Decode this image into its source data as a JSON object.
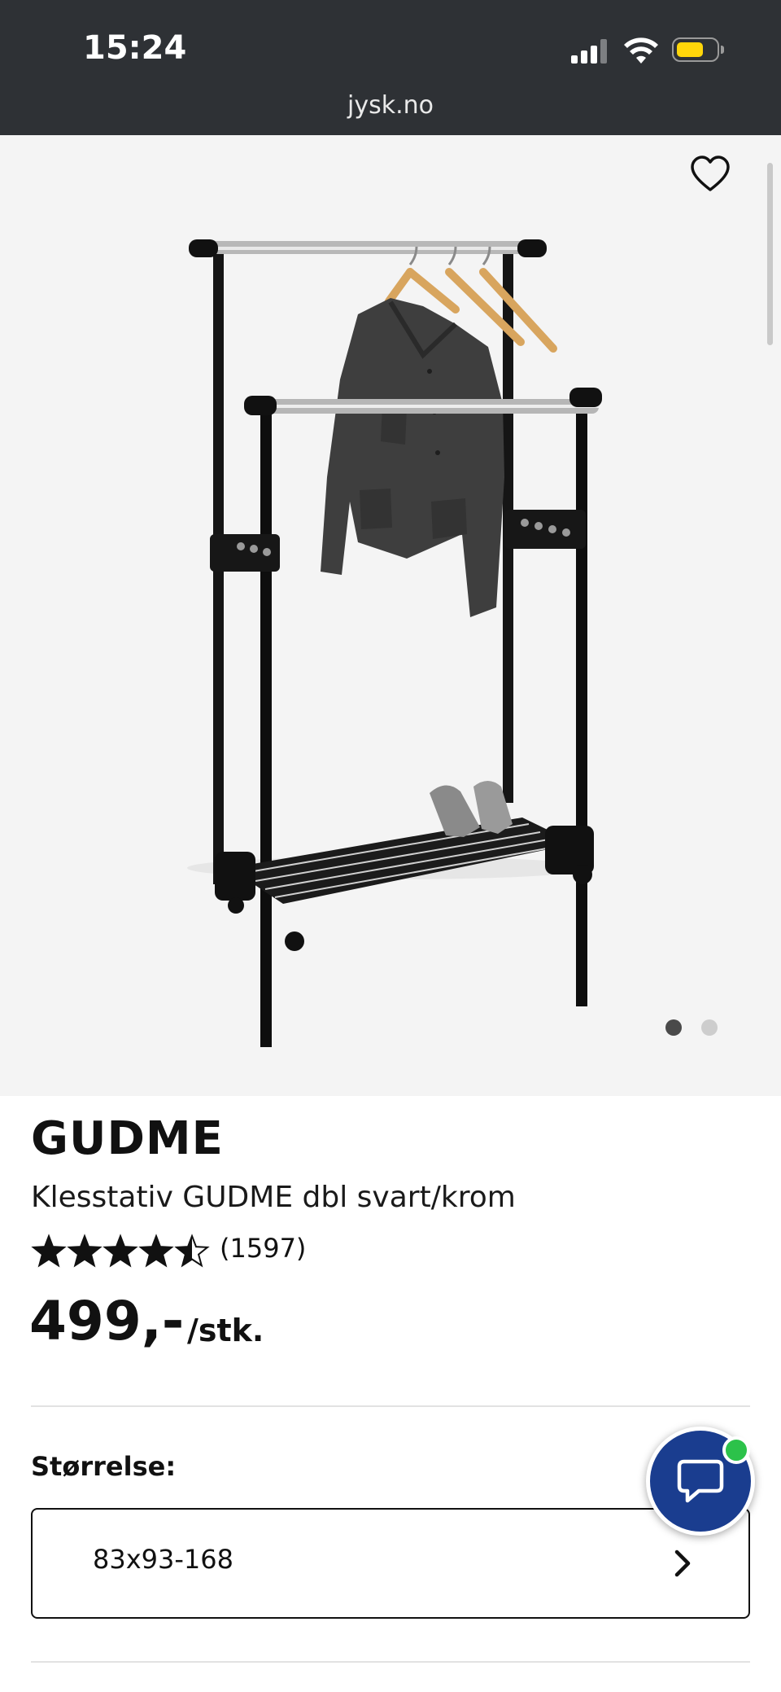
{
  "status_bar": {
    "time": "15:24",
    "url": "jysk.no",
    "battery_color": "#ffd60a"
  },
  "gallery": {
    "image_subject": "double clothes rack with jacket and shoes",
    "favorite_icon": "heart-outline-icon",
    "slides_total": 2,
    "active_slide": 1
  },
  "product": {
    "brand": "GUDME",
    "name": "Klesstativ GUDME dbl svart/krom",
    "rating": 4.5,
    "rating_max": 5,
    "review_count": "(1597)",
    "price": "499,-",
    "unit": "/stk."
  },
  "size": {
    "label": "Størrelse:",
    "value": "83x93-168",
    "chevron_icon": "chevron-right-icon"
  },
  "chat": {
    "icon": "chat-bubble-icon",
    "online_color": "#2cc24a",
    "button_color": "#1a3d8f"
  }
}
